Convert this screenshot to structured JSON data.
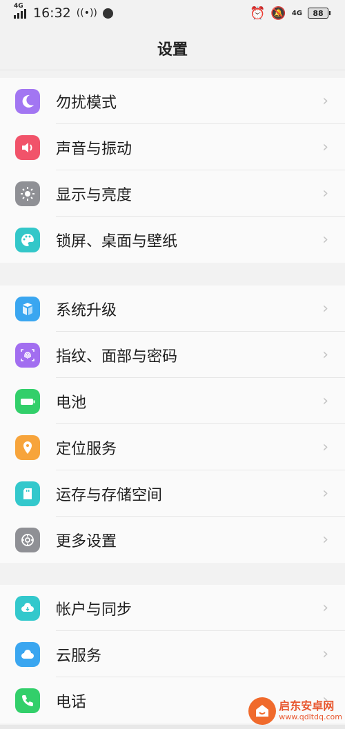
{
  "status_bar": {
    "network": "4G",
    "time": "16:32",
    "network_right": "4G",
    "battery": "88"
  },
  "header": {
    "title": "设置"
  },
  "groups": [
    {
      "items": [
        {
          "label": "勿扰模式",
          "icon": "moon-icon",
          "color": "#a276f2"
        },
        {
          "label": "声音与振动",
          "icon": "speaker-icon",
          "color": "#f1536a"
        },
        {
          "label": "显示与亮度",
          "icon": "sun-icon",
          "color": "#8f9095"
        },
        {
          "label": "锁屏、桌面与壁纸",
          "icon": "palette-icon",
          "color": "#33c7c9"
        }
      ]
    },
    {
      "items": [
        {
          "label": "系统升级",
          "icon": "update-icon",
          "color": "#3aa6f0"
        },
        {
          "label": "指纹、面部与密码",
          "icon": "fingerprint-icon",
          "color": "#a26ef0"
        },
        {
          "label": "电池",
          "icon": "battery-icon",
          "color": "#32cf6a"
        },
        {
          "label": "定位服务",
          "icon": "location-icon",
          "color": "#f7a43b"
        },
        {
          "label": "运存与存储空间",
          "icon": "sd-card-icon",
          "color": "#33c8cc"
        },
        {
          "label": "更多设置",
          "icon": "gear-icon",
          "color": "#8f9095"
        }
      ]
    },
    {
      "items": [
        {
          "label": "帐户与同步",
          "icon": "account-sync-icon",
          "color": "#33c8cc"
        },
        {
          "label": "云服务",
          "icon": "cloud-icon",
          "color": "#3aa6f0"
        },
        {
          "label": "电话",
          "icon": "phone-icon",
          "color": "#32cf6a"
        }
      ]
    }
  ],
  "watermark": {
    "title": "启东安卓网",
    "url": "www.qdltdq.com"
  }
}
